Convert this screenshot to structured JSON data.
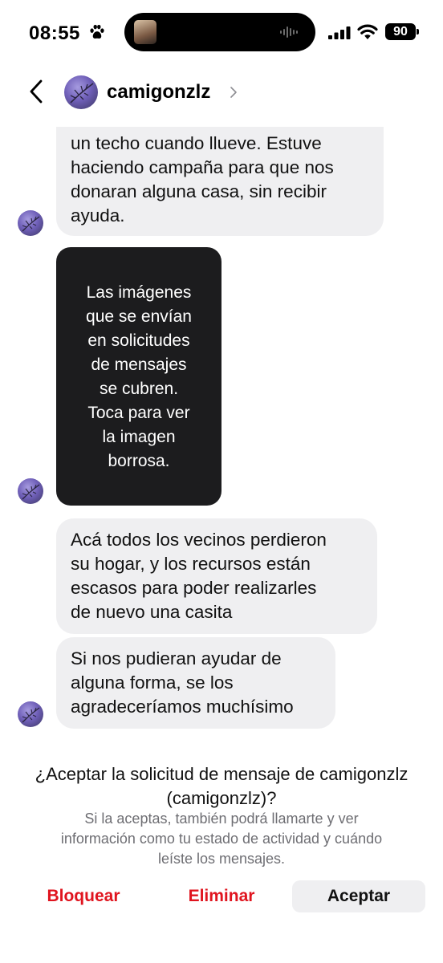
{
  "status_bar": {
    "time": "08:55",
    "battery": "90",
    "icons": [
      "paw-icon",
      "signal-icon",
      "wifi-icon",
      "battery-icon"
    ]
  },
  "header": {
    "username": "camigonzlz",
    "icons": [
      "back-arrow-icon",
      "chevron-right-icon"
    ]
  },
  "messages": [
    {
      "type": "text",
      "text": "un techo cuando llueve. Estuve\nhaciendo campaña para que nos\ndonaran alguna casa, sin recibir\nayuda."
    },
    {
      "type": "blurred_image",
      "text": "Las imágenes\nque se envían\nen solicitudes\nde mensajes\nse cubren.\nToca para ver\nla imagen\nborrosa."
    },
    {
      "type": "text",
      "text": "Acá todos los vecinos perdieron\nsu hogar, y los recursos están\nescasos para poder realizarles\nde nuevo una casita"
    },
    {
      "type": "text",
      "text": "Si nos pudieran ayudar de\nalguna forma, se los\nagradeceríamos muchísimo"
    }
  ],
  "request": {
    "title": "¿Aceptar la solicitud de mensaje de camigonzlz\n(camigonzlz)?",
    "description": "Si la aceptas, también podrá llamarte y ver\ninformación como tu estado de actividad y cuándo\nleíste los mensajes.",
    "block_label": "Bloquear",
    "delete_label": "Eliminar",
    "accept_label": "Aceptar"
  },
  "colors": {
    "bubble_bg": "#efeff1",
    "blur_card_bg": "#1c1c1e",
    "destructive": "#e0141e",
    "secondary_text": "#6e6e73"
  }
}
